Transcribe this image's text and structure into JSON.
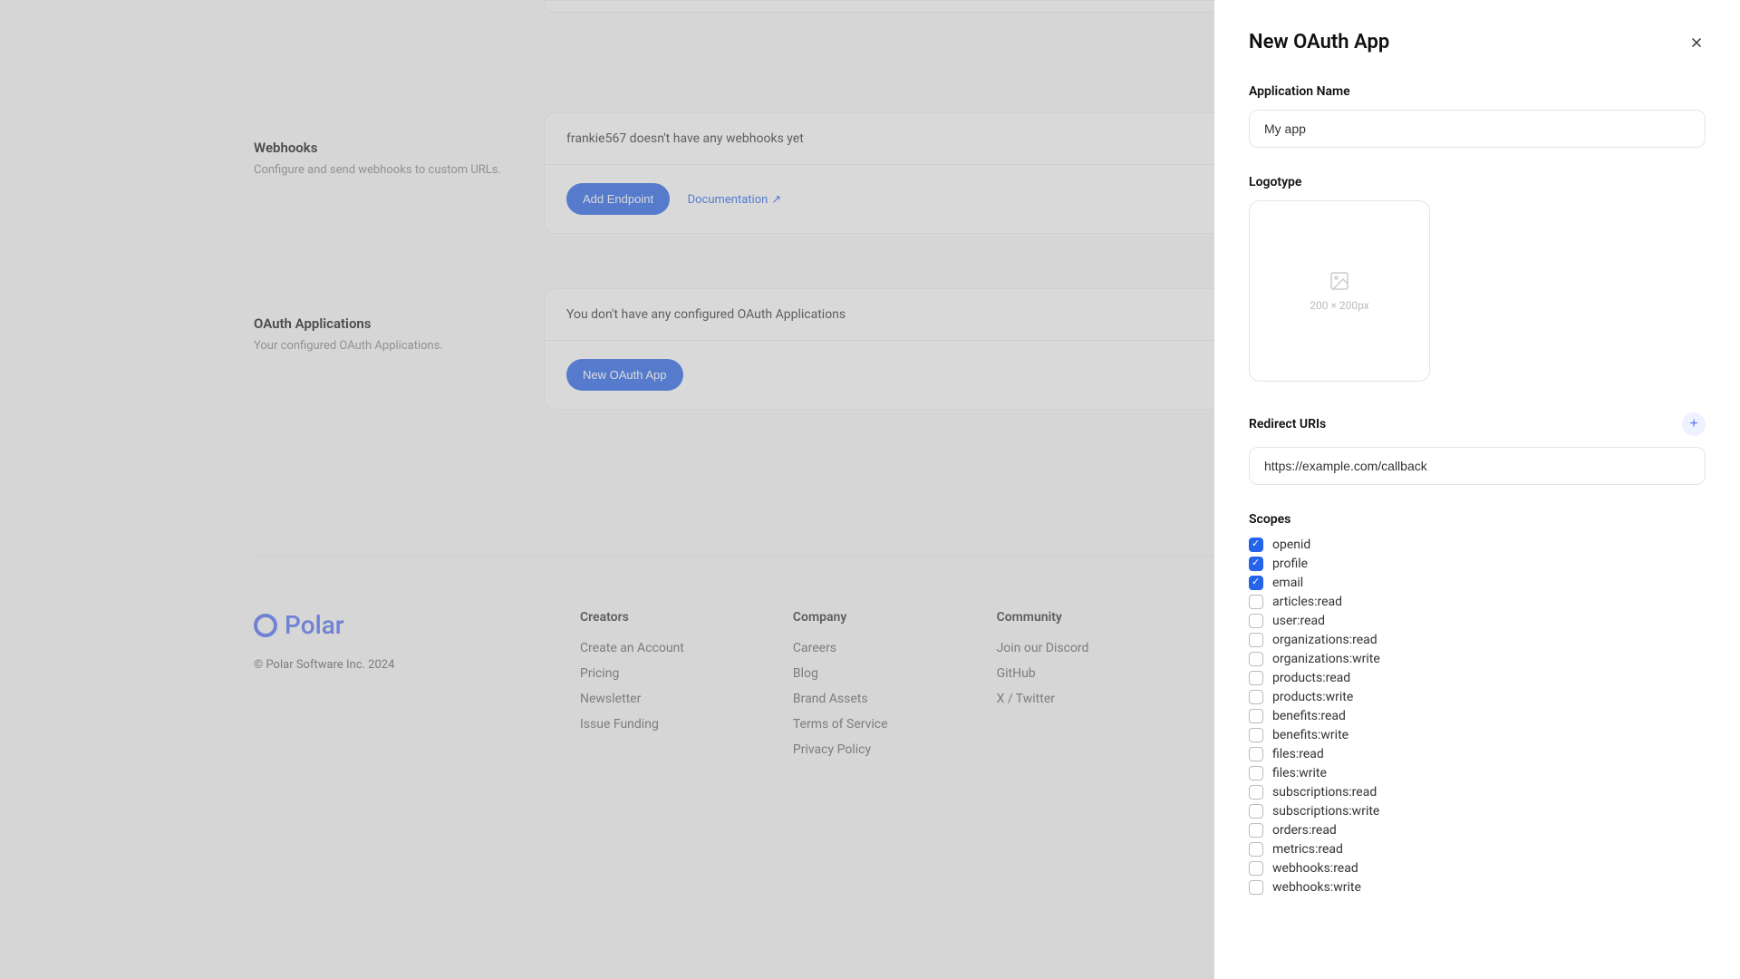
{
  "sections": {
    "webhooks": {
      "title": "Webhooks",
      "desc": "Configure and send webhooks to custom URLs.",
      "empty": "frankie567 doesn't have any webhooks yet",
      "add_btn": "Add Endpoint",
      "doc_link": "Documentation"
    },
    "oauth": {
      "title": "OAuth Applications",
      "desc": "Your configured OAuth Applications.",
      "empty": "You don't have any configured OAuth Applications",
      "new_btn": "New OAuth App"
    }
  },
  "footer": {
    "brand": "Polar",
    "copyright": "© Polar Software Inc. 2024",
    "cols": [
      {
        "title": "Creators",
        "links": [
          "Create an Account",
          "Pricing",
          "Newsletter",
          "Issue Funding"
        ]
      },
      {
        "title": "Company",
        "links": [
          "Careers",
          "Blog",
          "Brand Assets",
          "Terms of Service",
          "Privacy Policy"
        ]
      },
      {
        "title": "Community",
        "links": [
          "Join our Discord",
          "GitHub",
          "X / Twitter"
        ]
      }
    ]
  },
  "drawer": {
    "title": "New OAuth App",
    "fields": {
      "app_name_label": "Application Name",
      "app_name_value": "My app",
      "logotype_label": "Logotype",
      "logo_hint": "200 × 200px",
      "redirect_label": "Redirect URIs",
      "redirect_value": "https://example.com/callback",
      "scopes_label": "Scopes"
    },
    "scopes": [
      {
        "name": "openid",
        "checked": true
      },
      {
        "name": "profile",
        "checked": true
      },
      {
        "name": "email",
        "checked": true
      },
      {
        "name": "articles:read",
        "checked": false
      },
      {
        "name": "user:read",
        "checked": false
      },
      {
        "name": "organizations:read",
        "checked": false
      },
      {
        "name": "organizations:write",
        "checked": false
      },
      {
        "name": "products:read",
        "checked": false
      },
      {
        "name": "products:write",
        "checked": false
      },
      {
        "name": "benefits:read",
        "checked": false
      },
      {
        "name": "benefits:write",
        "checked": false
      },
      {
        "name": "files:read",
        "checked": false
      },
      {
        "name": "files:write",
        "checked": false
      },
      {
        "name": "subscriptions:read",
        "checked": false
      },
      {
        "name": "subscriptions:write",
        "checked": false
      },
      {
        "name": "orders:read",
        "checked": false
      },
      {
        "name": "metrics:read",
        "checked": false
      },
      {
        "name": "webhooks:read",
        "checked": false
      },
      {
        "name": "webhooks:write",
        "checked": false
      }
    ]
  }
}
